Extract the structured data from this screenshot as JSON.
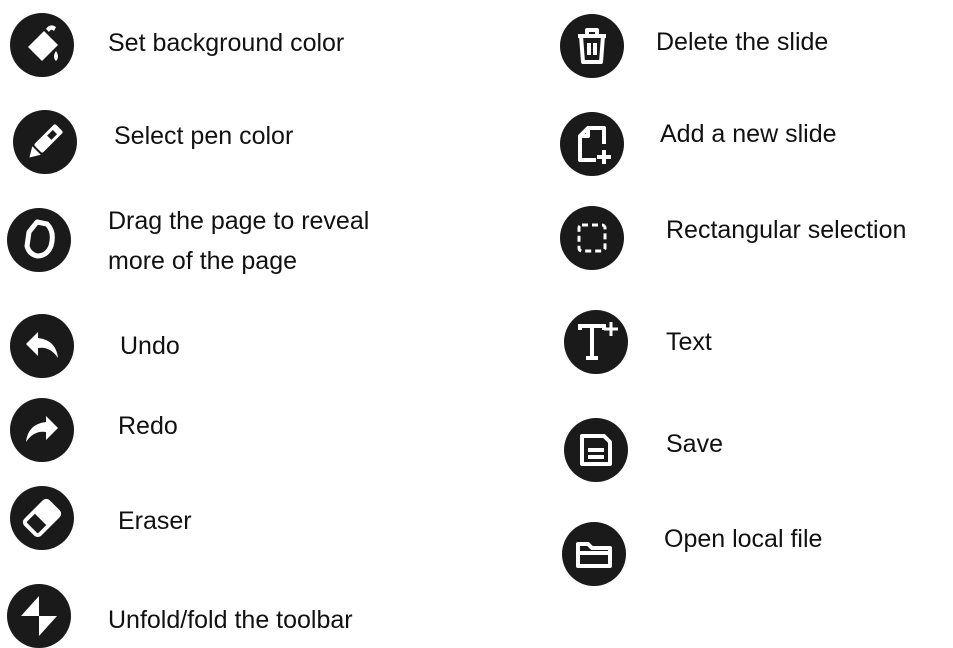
{
  "legend": {
    "left": [
      {
        "icon": "paint-bucket-icon",
        "label": "Set background color"
      },
      {
        "icon": "pen-icon",
        "label": "Select pen color"
      },
      {
        "icon": "hand-drag-icon",
        "label_line1": "Drag the page to reveal",
        "label_line2": "more of the page"
      },
      {
        "icon": "undo-icon",
        "label": "Undo"
      },
      {
        "icon": "redo-icon",
        "label": "Redo"
      },
      {
        "icon": "eraser-icon",
        "label": "Eraser"
      },
      {
        "icon": "toolbar-toggle-icon",
        "label": "Unfold/fold the toolbar"
      }
    ],
    "right": [
      {
        "icon": "trash-icon",
        "label": "Delete the slide"
      },
      {
        "icon": "add-slide-icon",
        "label": "Add a new slide"
      },
      {
        "icon": "rectangle-selection-icon",
        "label": "Rectangular selection"
      },
      {
        "icon": "text-add-icon",
        "label": "Text"
      },
      {
        "icon": "save-icon",
        "label": "Save"
      },
      {
        "icon": "folder-icon",
        "label": "Open local file"
      }
    ]
  },
  "colors": {
    "icon_background": "#1a1a1a",
    "icon_glyph": "#ffffff",
    "text": "#111111"
  }
}
